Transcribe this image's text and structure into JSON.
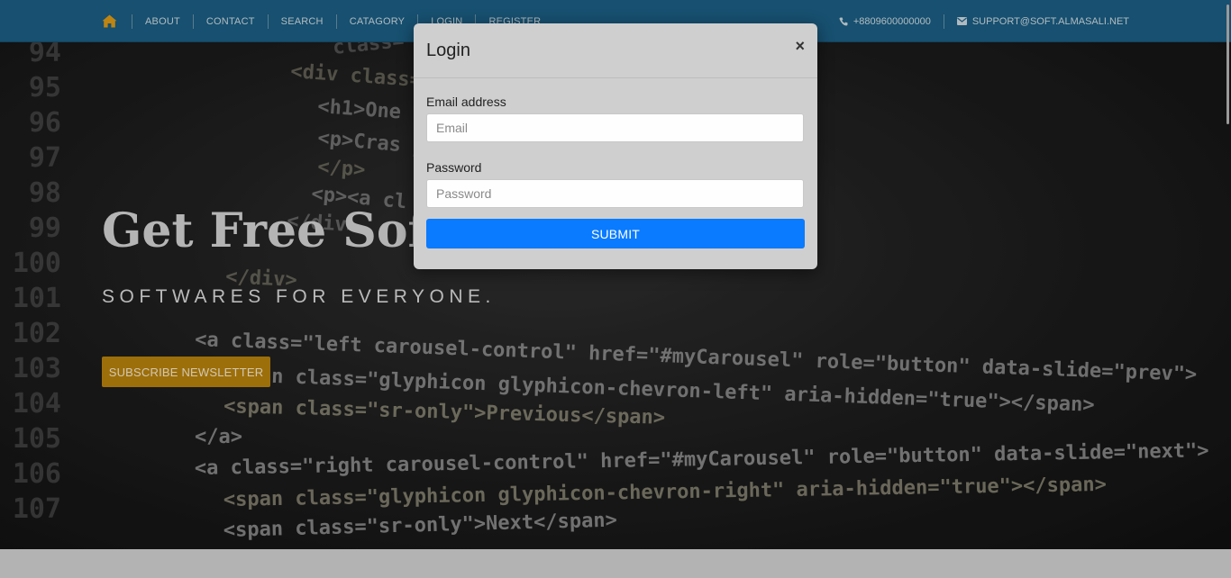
{
  "nav": {
    "items": [
      "ABOUT",
      "CONTACT",
      "SEARCH",
      "CATAGORY",
      "LOGIN",
      "REGISTER"
    ],
    "phone": "+8809600000000",
    "email": "SUPPORT@SOFT.ALMASALI.NET"
  },
  "hero": {
    "title": "Get Free Software",
    "subtitle": "SOFTWARES FOR EVERYONE.",
    "cta_label": "SUBSCRIBE NEWSLETTER"
  },
  "modal": {
    "title": "Login",
    "close_symbol": "×",
    "email_label": "Email address",
    "email_placeholder": "Email",
    "password_label": "Password",
    "password_placeholder": "Password",
    "submit_label": "SUBMIT"
  },
  "background_code": {
    "line_numbers": [
      "94",
      "95",
      "96",
      "97",
      "98",
      "99",
      "100",
      "101",
      "102",
      "103",
      "104",
      "105",
      "106",
      "107"
    ],
    "lines": [
      "class=\"grey/gif\">",
      "<div class=\"jumbotron\">",
      "<h1>One",
      "<p>Cras justo odio, dapibus",
      "</p>",
      "<p><a cl",
      "</div>",
      "</div>",
      "<a class=\"left carousel-control\" href=\"#myCarousel\" role=\"button\" data-slide=\"prev\">",
      "<span class=\"glyphicon glyphicon-chevron-left\" aria-hidden=\"true\"></span>",
      "<span class=\"sr-only\">Previous</span>",
      "</a>",
      "<a class=\"right carousel-control\" href=\"#myCarousel\" role=\"button\" data-slide=\"next\">",
      "<span class=\"glyphicon glyphicon-chevron-right\" aria-hidden=\"true\"></span>",
      "<span class=\"sr-only\">Next</span>"
    ]
  },
  "icons": {
    "home": "home-icon",
    "phone": "phone-icon",
    "email": "envelope-icon",
    "close": "close-icon"
  },
  "colors": {
    "navbar": "#1d6289",
    "home_icon": "#e8a317",
    "cta": "#c0880d",
    "submit": "#0a7bff"
  }
}
